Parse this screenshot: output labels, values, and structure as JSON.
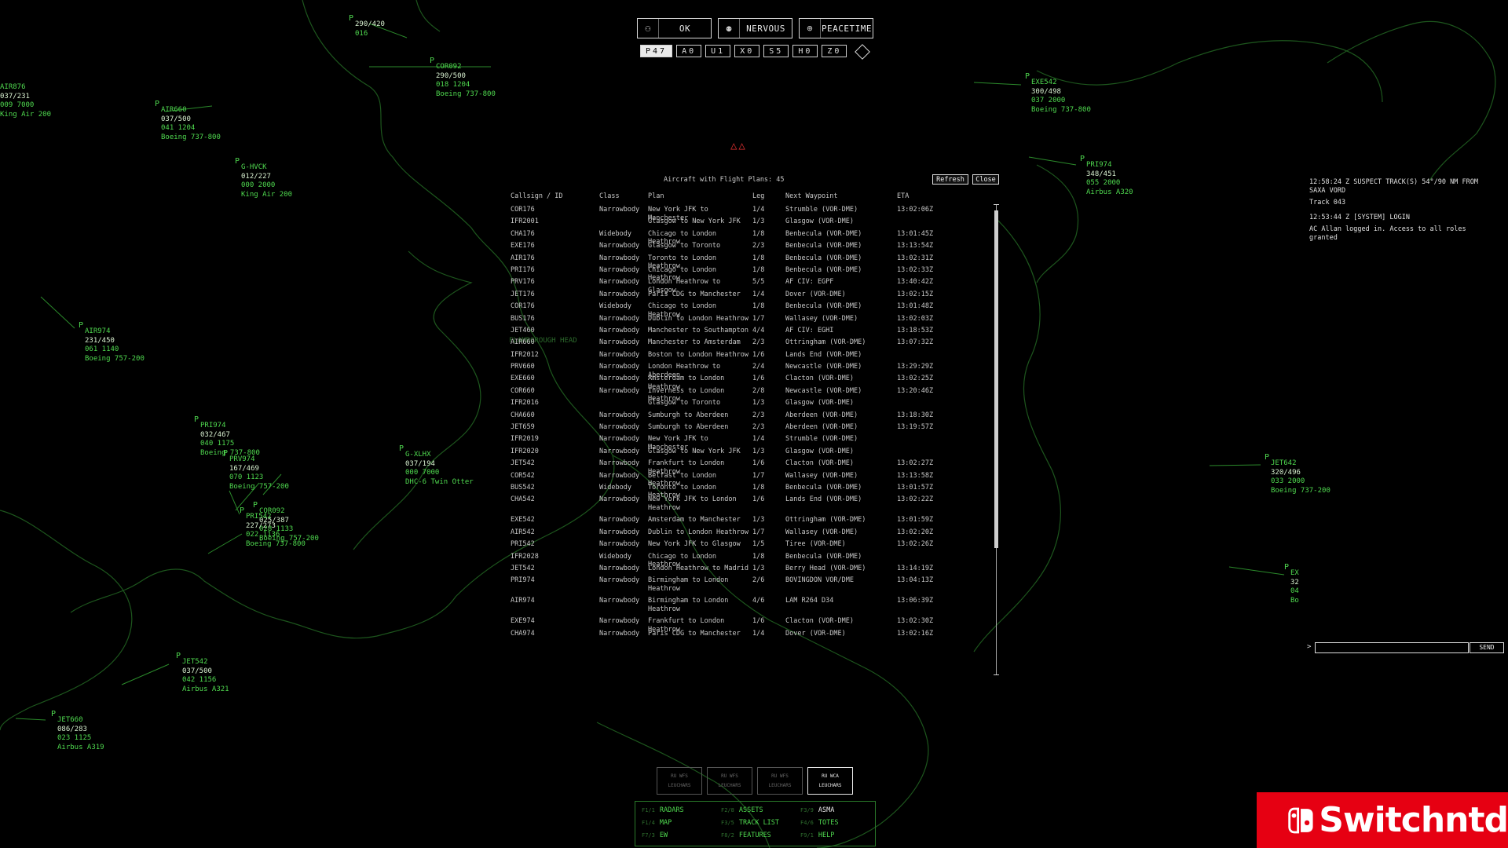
{
  "status_bar": {
    "threat": "OK",
    "mood": "NERVOUS",
    "state": "PEACETIME"
  },
  "counters": [
    {
      "key": "P",
      "value": "47",
      "active": true
    },
    {
      "key": "A",
      "value": "0",
      "active": false
    },
    {
      "key": "U",
      "value": "1",
      "active": false
    },
    {
      "key": "X",
      "value": "0",
      "active": false
    },
    {
      "key": "S",
      "value": "5",
      "active": false
    },
    {
      "key": "H",
      "value": "0",
      "active": false
    },
    {
      "key": "Z",
      "value": "0",
      "active": false
    }
  ],
  "flight_plans": {
    "title": "Aircraft with Flight Plans: 45",
    "refresh_label": "Refresh",
    "close_label": "Close",
    "columns": [
      "Callsign / ID",
      "Class",
      "Plan",
      "Leg",
      "Next Waypoint",
      "ETA"
    ],
    "rows": [
      [
        "COR176",
        "Narrowbody",
        "New York JFK to Manchester",
        "1/4",
        "Strumble (VOR-DME)",
        "13:02:06Z"
      ],
      [
        "IFR2001",
        "",
        "Glasgow to New York JFK",
        "1/3",
        "Glasgow (VOR-DME)",
        ""
      ],
      [
        "CHA176",
        "Widebody",
        "Chicago to London Heathrow",
        "1/8",
        "Benbecula (VOR-DME)",
        "13:01:45Z"
      ],
      [
        "EXE176",
        "Narrowbody",
        "Glasgow to Toronto",
        "2/3",
        "Benbecula (VOR-DME)",
        "13:13:54Z"
      ],
      [
        "AIR176",
        "Narrowbody",
        "Toronto to London Heathrow",
        "1/8",
        "Benbecula (VOR-DME)",
        "13:02:31Z"
      ],
      [
        "PRI176",
        "Narrowbody",
        "Chicago to London Heathrow",
        "1/8",
        "Benbecula (VOR-DME)",
        "13:02:33Z"
      ],
      [
        "PRV176",
        "Narrowbody",
        "London Heathrow to Glasgow",
        "5/5",
        "AF CIV: EGPF",
        "13:40:42Z"
      ],
      [
        "JET176",
        "Narrowbody",
        "Paris CDG to Manchester",
        "1/4",
        "Dover (VOR-DME)",
        "13:02:15Z"
      ],
      [
        "COR176",
        "Widebody",
        "Chicago to London Heathrow",
        "1/8",
        "Benbecula (VOR-DME)",
        "13:01:48Z"
      ],
      [
        "BUS176",
        "Narrowbody",
        "Dublin to London Heathrow",
        "1/7",
        "Wallasey (VOR-DME)",
        "13:02:03Z"
      ],
      [
        "JET460",
        "Narrowbody",
        "Manchester to Southampton",
        "4/4",
        "AF CIV: EGHI",
        "13:18:53Z"
      ],
      [
        "AIR660",
        "Narrowbody",
        "Manchester to Amsterdam",
        "2/3",
        "Ottringham (VOR-DME)",
        "13:07:32Z"
      ],
      [
        "IFR2012",
        "Narrowbody",
        "Boston to London Heathrow",
        "1/6",
        "Lands End (VOR-DME)",
        ""
      ],
      [
        "PRV660",
        "Narrowbody",
        "London Heathrow to Aberdeen",
        "2/4",
        "Newcastle (VOR-DME)",
        "13:29:29Z"
      ],
      [
        "EXE660",
        "Narrowbody",
        "Amsterdam to London Heathrow",
        "1/6",
        "Clacton (VOR-DME)",
        "13:02:25Z"
      ],
      [
        "COR660",
        "Narrowbody",
        "Inverness to London Heathrow",
        "2/8",
        "Newcastle (VOR-DME)",
        "13:20:46Z"
      ],
      [
        "IFR2016",
        "",
        "Glasgow to Toronto",
        "1/3",
        "Glasgow (VOR-DME)",
        ""
      ],
      [
        "CHA660",
        "Narrowbody",
        "Sumburgh to Aberdeen",
        "2/3",
        "Aberdeen (VOR-DME)",
        "13:18:30Z"
      ],
      [
        "JET659",
        "Narrowbody",
        "Sumburgh to Aberdeen",
        "2/3",
        "Aberdeen (VOR-DME)",
        "13:19:57Z"
      ],
      [
        "IFR2019",
        "Narrowbody",
        "New York JFK to Manchester",
        "1/4",
        "Strumble (VOR-DME)",
        ""
      ],
      [
        "IFR2020",
        "Narrowbody",
        "Glasgow to New York JFK",
        "1/3",
        "Glasgow (VOR-DME)",
        ""
      ],
      [
        "JET542",
        "Narrowbody",
        "Frankfurt to London Heathrow",
        "1/6",
        "Clacton (VOR-DME)",
        "13:02:27Z"
      ],
      [
        "COR542",
        "Narrowbody",
        "Belfast to London Heathrow",
        "1/7",
        "Wallasey (VOR-DME)",
        "13:13:58Z"
      ],
      [
        "BUS542",
        "Widebody",
        "Toronto to London Heathrow",
        "1/8",
        "Benbecula (VOR-DME)",
        "13:01:57Z"
      ],
      [
        "CHA542",
        "Narrowbody",
        "New York JFK to London Heathrow",
        "1/6",
        "Lands End (VOR-DME)",
        "13:02:22Z"
      ],
      [
        "EXE542",
        "Narrowbody",
        "Amsterdam to Manchester",
        "1/3",
        "Ottringham (VOR-DME)",
        "13:01:59Z"
      ],
      [
        "AIR542",
        "Narrowbody",
        "Dublin to London Heathrow",
        "1/7",
        "Wallasey (VOR-DME)",
        "13:02:20Z"
      ],
      [
        "PRI542",
        "Narrowbody",
        "New York JFK to Glasgow",
        "1/5",
        "Tiree (VOR-DME)",
        "13:02:26Z"
      ],
      [
        "IFR2028",
        "Widebody",
        "Chicago to London Heathrow",
        "1/8",
        "Benbecula (VOR-DME)",
        ""
      ],
      [
        "JET542",
        "Narrowbody",
        "London Heathrow to Madrid",
        "1/3",
        "Berry Head (VOR-DME)",
        "13:14:19Z"
      ],
      [
        "PRI974",
        "Narrowbody",
        "Birmingham to London Heathrow",
        "2/6",
        "BOVINGDON VOR/DME",
        "13:04:13Z"
      ],
      [
        "AIR974",
        "Narrowbody",
        "Birmingham to London Heathrow",
        "4/6",
        "LAM R264 D34",
        "13:06:39Z"
      ],
      [
        "EXE974",
        "Narrowbody",
        "Frankfurt to London Heathrow",
        "1/6",
        "Clacton (VOR-DME)",
        "13:02:30Z"
      ],
      [
        "CHA974",
        "Narrowbody",
        "Paris CDG to Manchester",
        "1/4",
        "Dover (VOR-DME)",
        "13:02:16Z"
      ]
    ]
  },
  "map_label": "FLAMBOROUGH HEAD",
  "tracks": [
    {
      "cs": "",
      "l1": "290/420",
      "l2": "016",
      "l3": ""
    },
    {
      "cs": "COR092",
      "l1": "290/500",
      "l2": "018 1204",
      "l3": "Boeing 737-800"
    },
    {
      "cs": "AIR660",
      "l1": "037/500",
      "l2": "041 1204",
      "l3": "Boeing 737-800"
    },
    {
      "cs": "AIR876",
      "l1": "037/231",
      "l2": "009 7000",
      "l3": "King Air 200"
    },
    {
      "cs": "G-HVCK",
      "l1": "012/227",
      "l2": "000 2000",
      "l3": "King Air 200"
    },
    {
      "cs": "AIR974",
      "l1": "231/450",
      "l2": "061 1140",
      "l3": "Boeing 757-200"
    },
    {
      "cs": "PRI974",
      "l1": "032/467",
      "l2": "040 1175",
      "l3": "Boeing 737-800"
    },
    {
      "cs": "PRV974",
      "l1": "167/469",
      "l2": "070 1123",
      "l3": "Boeing 757-200"
    },
    {
      "cs": "COR092",
      "l1": "025/387",
      "l2": "028 1133",
      "l3": "Boeing 757-200"
    },
    {
      "cs": "PRI542",
      "l1": "227/273",
      "l2": "022 1136",
      "l3": "Boeing 737-800"
    },
    {
      "cs": "G-XLHX",
      "l1": "037/194",
      "l2": "000 7000",
      "l3": "DHC-6 Twin Otter"
    },
    {
      "cs": "JET542",
      "l1": "037/500",
      "l2": "042 1156",
      "l3": "Airbus A321"
    },
    {
      "cs": "JET660",
      "l1": "086/283",
      "l2": "023 1125",
      "l3": "Airbus A319"
    },
    {
      "cs": "EXE542",
      "l1": "300/498",
      "l2": "037 2000",
      "l3": "Boeing 737-800"
    },
    {
      "cs": "PRI974",
      "l1": "348/451",
      "l2": "055 2000",
      "l3": "Airbus A320"
    },
    {
      "cs": "JET642",
      "l1": "320/496",
      "l2": "033 2000",
      "l3": "Boeing 737-200"
    },
    {
      "cs": "EX",
      "l1": "32",
      "l2": "04",
      "l3": "Bo"
    }
  ],
  "log": [
    "12:58:24 Z  SUSPECT TRACK(S) 54°/90 NM FROM SAXA VORD",
    "Track 043",
    "12:53:44 Z [SYSTEM]  LOGIN",
    "AC Allan logged in. Access to all roles granted"
  ],
  "command": {
    "prompt": ">",
    "send_label": "SEND"
  },
  "radars": [
    {
      "top": "RU WFS",
      "bottom": "LEUCHARS",
      "active": false
    },
    {
      "top": "RU WFS",
      "bottom": "LEUCHARS",
      "active": false
    },
    {
      "top": "RU WFS",
      "bottom": "LEUCHARS",
      "active": false
    },
    {
      "top": "RU WCA",
      "bottom": "LEUCHARS",
      "active": true
    }
  ],
  "menu": [
    {
      "key": "F1/1",
      "label": "RADARS"
    },
    {
      "key": "F2/8",
      "label": "ASSETS"
    },
    {
      "key": "F3/9",
      "label": "ASMA"
    },
    {
      "key": "F1/4",
      "label": "MAP"
    },
    {
      "key": "F3/5",
      "label": "TRACK LIST"
    },
    {
      "key": "F4/6",
      "label": "TOTES"
    },
    {
      "key": "F7/3",
      "label": "EW"
    },
    {
      "key": "F8/2",
      "label": "FEATURES"
    },
    {
      "key": "F9/1",
      "label": "HELP"
    }
  ],
  "logo_text": "Switchntd",
  "colors": {
    "track": "#4fd94f",
    "coast": "#1f5a1f",
    "alert": "#e03030",
    "brand": "#e60012"
  }
}
